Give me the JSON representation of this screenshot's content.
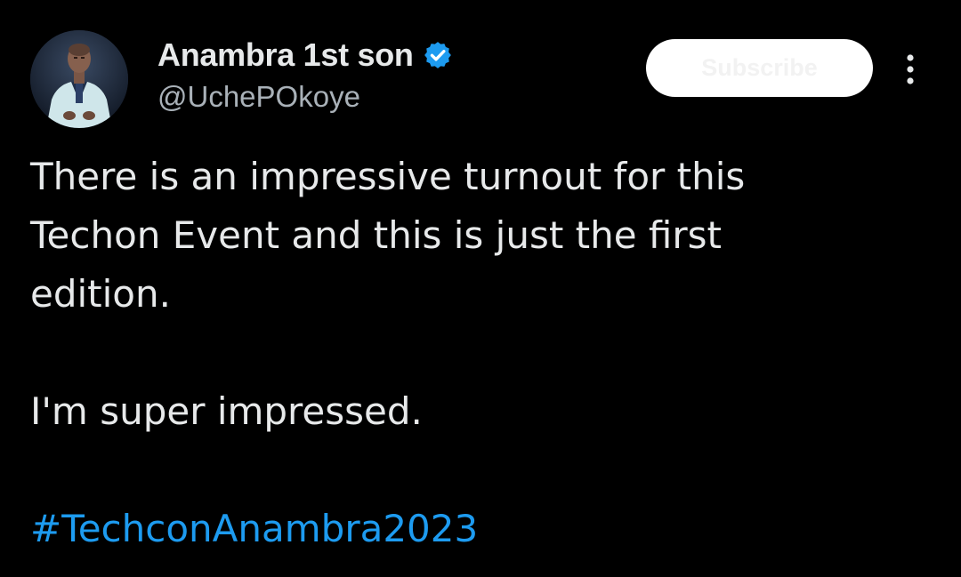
{
  "author": {
    "display_name": "Anambra 1st son",
    "handle": "@UchePOkoye",
    "verified": true,
    "avatar_icon": "profile-avatar"
  },
  "actions": {
    "subscribe_label": "Subscribe",
    "more_icon": "vertical-ellipsis-icon"
  },
  "tweet": {
    "lines": [
      "There is an impressive turnout for this",
      "Techon Event and this is just the first",
      "edition."
    ],
    "line2": "I'm super impressed.",
    "hashtag": "#TechconAnambra2023"
  },
  "colors": {
    "background": "#000000",
    "text": "#e7e9ea",
    "handle": "#a9b1b8",
    "link": "#1d9bf0",
    "verified_badge": "#1d9bf0",
    "subscribe_bg": "#ffffff"
  }
}
